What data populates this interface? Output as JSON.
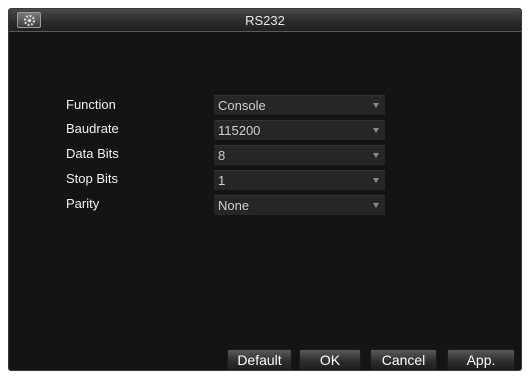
{
  "window": {
    "title": "RS232",
    "icon": "settings-gear-icon"
  },
  "form": {
    "fields": [
      {
        "label": "Function",
        "value": "Console"
      },
      {
        "label": "Baudrate",
        "value": "115200"
      },
      {
        "label": "Data Bits",
        "value": "8"
      },
      {
        "label": "Stop Bits",
        "value": "1"
      },
      {
        "label": "Parity",
        "value": "None"
      }
    ]
  },
  "buttons": {
    "default": "Default",
    "ok": "OK",
    "cancel": "Cancel",
    "apply": "App."
  },
  "colors": {
    "background": "#141414",
    "field": "#262626",
    "text": "#f2f2f2"
  }
}
